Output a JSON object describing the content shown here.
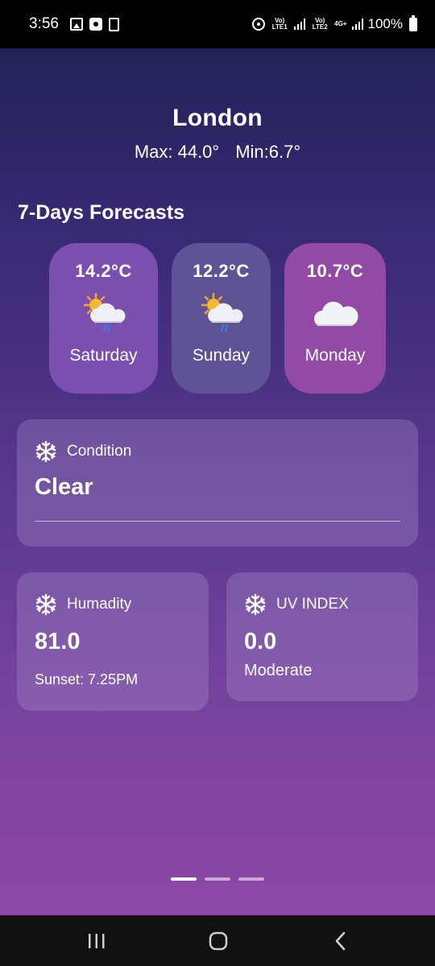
{
  "status_bar": {
    "time": "3:56",
    "net1": "Vo) LTE1",
    "net2": "Vo) LTE2",
    "net3": "4G+",
    "battery": "100%"
  },
  "weather": {
    "city": "London",
    "max": "Max: 44.0°",
    "min": "Min:6.7°"
  },
  "forecast": {
    "title": "7-Days Forecasts",
    "days": [
      {
        "temp": "14.2°C",
        "day": "Saturday",
        "icon": "sun-cloud-rain-icon",
        "color": "#7a4fb0"
      },
      {
        "temp": "12.2°C",
        "day": "Sunday",
        "icon": "sun-cloud-rain-icon",
        "color": "#5f5396"
      },
      {
        "temp": "10.7°C",
        "day": "Monday",
        "icon": "cloud-icon",
        "color": "#924aa4"
      }
    ]
  },
  "condition": {
    "label": "Condition",
    "value": "Clear",
    "icon": "snowflake-icon"
  },
  "humidity": {
    "label": "Humadity",
    "value": "81.0",
    "sub": "Sunset: 7.25PM",
    "icon": "snowflake-icon"
  },
  "uv": {
    "label": "UV INDEX",
    "value": "0.0",
    "sub": "Moderate",
    "icon": "snowflake-icon"
  },
  "pager": {
    "pages": 3,
    "active": 1
  }
}
